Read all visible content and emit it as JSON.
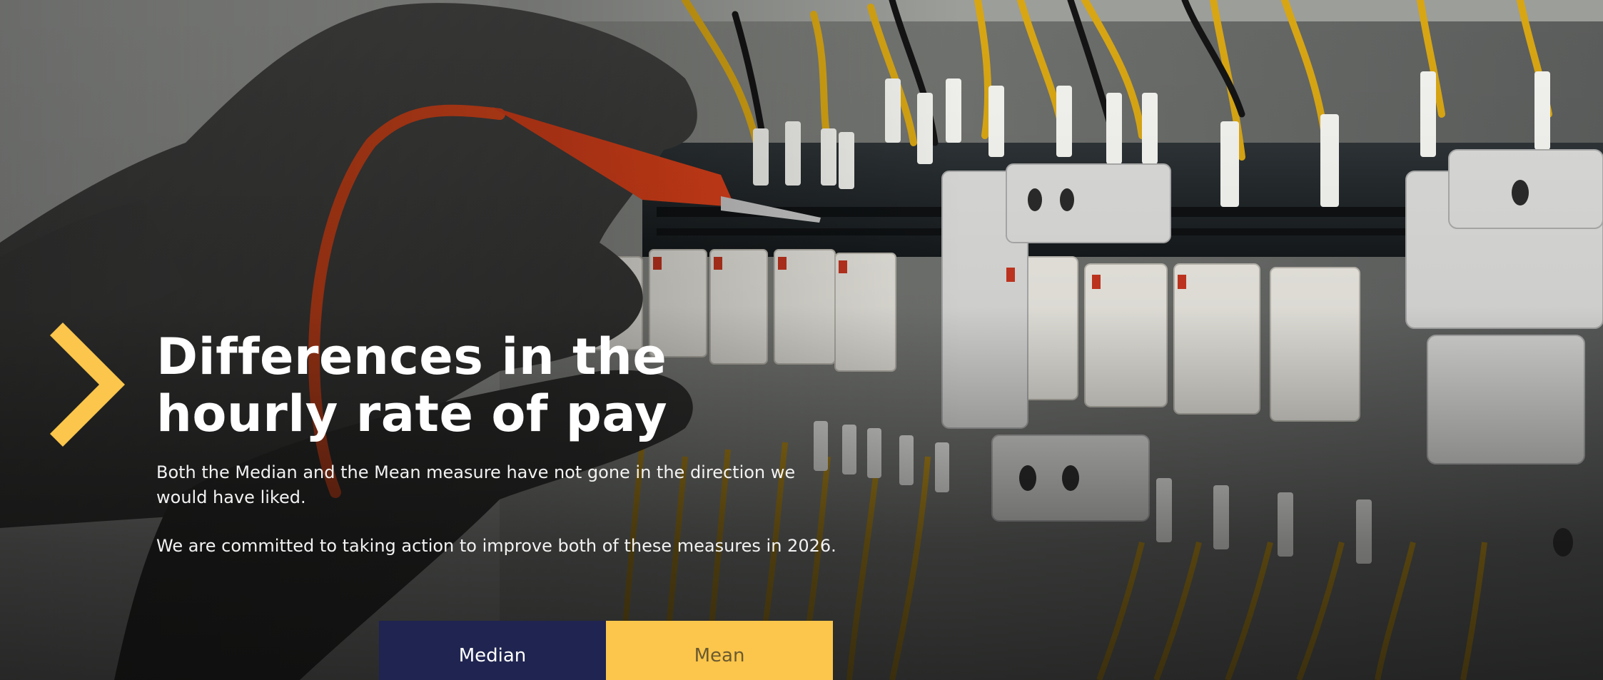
{
  "hero": {
    "title_line1": "Differences in the",
    "title_line2": "hourly rate of pay",
    "paragraph1": "Both the Median and the Mean measure have not gone in the direction we would have liked.",
    "paragraph2": "We are committed to taking action to improve both of these measures in 2026."
  },
  "tabs": [
    {
      "label": "Median",
      "active": true
    },
    {
      "label": "Mean",
      "active": false
    }
  ],
  "colors": {
    "accent_yellow": "#fbc64b",
    "navy": "#1f2450",
    "text_white": "#ffffff"
  },
  "icons": {
    "chevron": "chevron-right-icon"
  }
}
